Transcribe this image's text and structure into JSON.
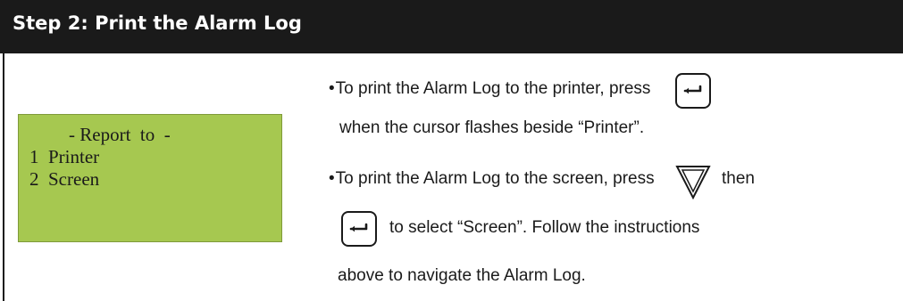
{
  "header": {
    "title": "Step 2: Print the Alarm Log"
  },
  "lcd": {
    "title": "- Report  to  -",
    "options": [
      "1  Printer",
      "2  Screen"
    ]
  },
  "instructions": {
    "bullet": "•",
    "line1": "To print the Alarm Log to the printer, press",
    "line2": "when the cursor flashes beside “Printer”.",
    "line3": "To print the Alarm Log to the screen, press",
    "line3_after": "then",
    "line4": "to select “Screen”. Follow the instructions",
    "line5": "above to navigate the Alarm Log."
  },
  "icons": {
    "enter": "enter-key-icon",
    "down": "down-arrow-key-icon"
  },
  "colors": {
    "header_bg": "#1a1a1a",
    "header_text": "#ffffff",
    "lcd_bg": "#a6c850",
    "text": "#1a1a1a"
  }
}
